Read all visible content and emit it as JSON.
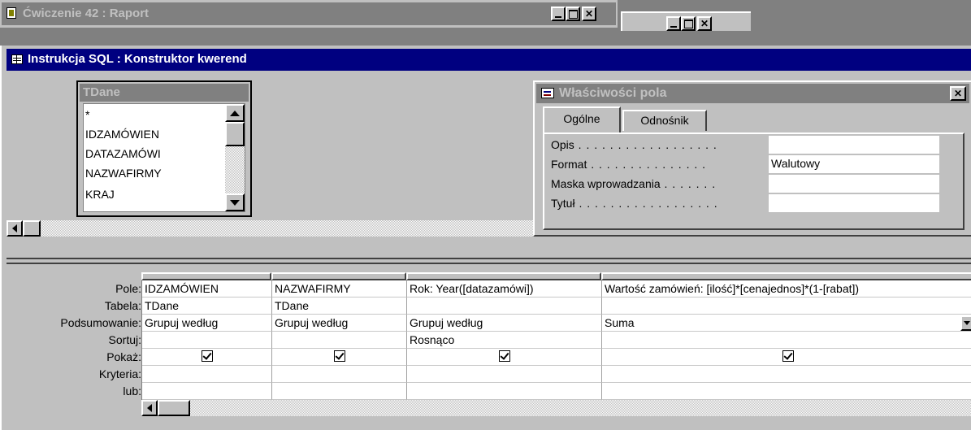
{
  "report_window": {
    "title": "Ćwiczenie 42 : Raport"
  },
  "query_window": {
    "title": "Instrukcja SQL : Konstruktor kwerend"
  },
  "table_box": {
    "title": "TDane",
    "fields": [
      "*",
      "IDZAMÓWIEN",
      "DATAZAMÓWI",
      "NAZWAFIRMY",
      "KRAJ"
    ]
  },
  "properties": {
    "title": "Właściwości pola",
    "tabs": [
      "Ogólne",
      "Odnośnik"
    ],
    "rows": [
      {
        "label": "Opis",
        "dots": " . . . . . . . . . . . . . . . . . .",
        "value": ""
      },
      {
        "label": "Format",
        "dots": " . . . . . . . . . . . . . . .",
        "value": "Walutowy"
      },
      {
        "label": "Maska wprowadzania",
        "dots": " . . . . . . .",
        "value": ""
      },
      {
        "label": "Tytuł",
        "dots": " . . . . . . . . . . . . . . . . . .",
        "value": ""
      }
    ]
  },
  "grid": {
    "row_labels": [
      "Pole:",
      "Tabela:",
      "Podsumowanie:",
      "Sortuj:",
      "Pokaż:",
      "Kryteria:",
      "lub:"
    ],
    "columns": [
      {
        "pole": "IDZAMÓWIEN",
        "tabela": "TDane",
        "podsumowanie": "Grupuj według",
        "sortuj": "",
        "pokaz": true
      },
      {
        "pole": "NAZWAFIRMY",
        "tabela": "TDane",
        "podsumowanie": "Grupuj według",
        "sortuj": "",
        "pokaz": true
      },
      {
        "pole": "Rok: Year([datazamówi])",
        "tabela": "",
        "podsumowanie": "Grupuj według",
        "sortuj": "Rosnąco",
        "pokaz": true
      },
      {
        "pole": "Wartość zamówień: [ilość]*[cenajednos]*(1-[rabat])",
        "tabela": "",
        "podsumowanie": "Suma",
        "sortuj": "",
        "pokaz": true
      }
    ]
  }
}
